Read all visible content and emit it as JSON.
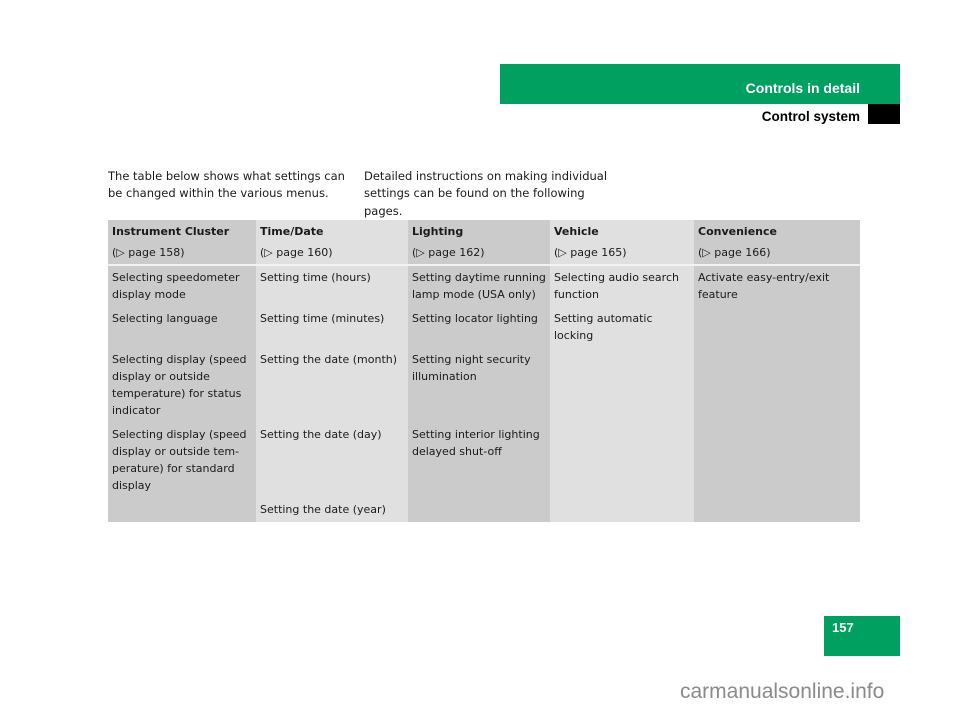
{
  "header": {
    "chapter": "Controls in detail",
    "section": "Control system"
  },
  "intro": {
    "left": "The table below shows what settings can be changed within the various menus.",
    "right": "Detailed instructions on making individual settings can be found on the following pages."
  },
  "table": {
    "columns": [
      {
        "title": "Instrument Cluster",
        "ref": "(▷ page 158)"
      },
      {
        "title": "Time/Date",
        "ref": "(▷ page 160)"
      },
      {
        "title": "Lighting",
        "ref": "(▷ page 162)"
      },
      {
        "title": "Vehicle",
        "ref": "(▷ page 165)"
      },
      {
        "title": "Convenience",
        "ref": "(▷ page 166)"
      }
    ],
    "rows": [
      [
        "Selecting speedometer display mode",
        "Setting time (hours)",
        "Setting daytime running lamp mode (USA only)",
        "Selecting audio search function",
        "Activate easy-entry/exit feature"
      ],
      [
        "Selecting language",
        "Setting time (minutes)",
        "Setting locator lighting",
        "Setting automatic locking",
        ""
      ],
      [
        "Selecting display (speed display or outside temperature) for status indicator",
        "Setting the date (month)",
        "Setting night security illumination",
        "",
        ""
      ],
      [
        "Selecting display (speed display or outside tem-perature) for standard display",
        "Setting the date (day)",
        "Setting interior lighting delayed shut-off",
        "",
        ""
      ],
      [
        "",
        "Setting the date (year)",
        "",
        "",
        ""
      ]
    ]
  },
  "footer": {
    "page_number": "157",
    "watermark": "carmanualsonline.info"
  },
  "colors": {
    "brand_green": "#00a060",
    "cell_dark": "#cbcbcb",
    "cell_light": "#e0e0e0"
  }
}
